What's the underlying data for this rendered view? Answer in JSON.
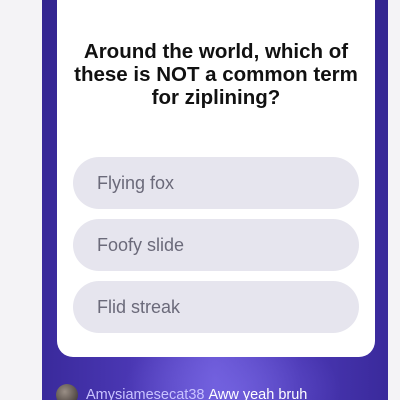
{
  "quiz": {
    "question": "Around the world, which of these is NOT a common term for ziplining?",
    "answers": [
      "Flying fox",
      "Foofy slide",
      "Flid streak"
    ]
  },
  "chat": {
    "username": "Amysiamesecat38",
    "message": "Aww yeah bruh",
    "avatar_icon": "user-avatar"
  },
  "colors": {
    "background_outer": "#f4f3f6",
    "stage_purple": "#3a2a9c",
    "card": "#ffffff",
    "answer_pill": "#e6e5ee",
    "answer_text": "#6b6a7a",
    "username_color": "#c9c3ff"
  }
}
